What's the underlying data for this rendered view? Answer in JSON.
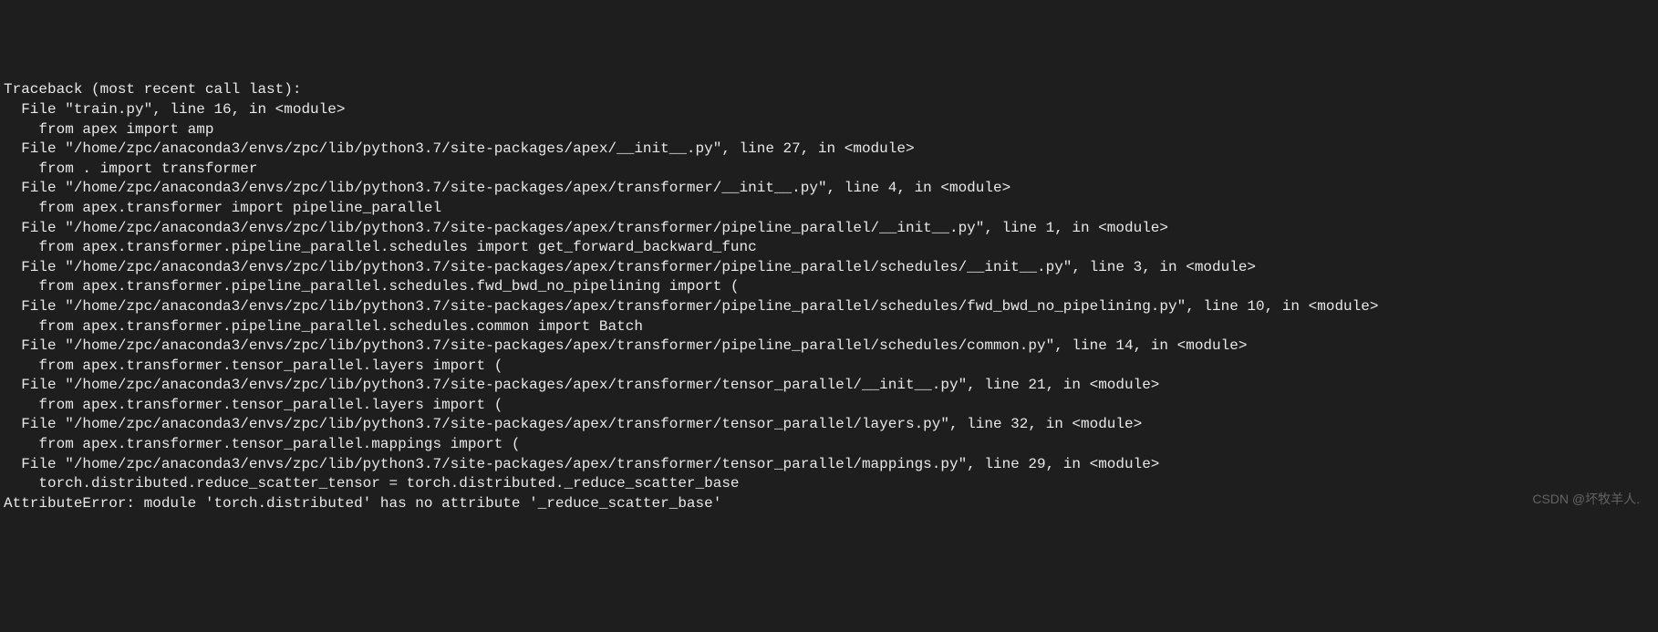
{
  "terminal": {
    "lines": [
      "Traceback (most recent call last):",
      "  File \"train.py\", line 16, in <module>",
      "    from apex import amp",
      "  File \"/home/zpc/anaconda3/envs/zpc/lib/python3.7/site-packages/apex/__init__.py\", line 27, in <module>",
      "    from . import transformer",
      "  File \"/home/zpc/anaconda3/envs/zpc/lib/python3.7/site-packages/apex/transformer/__init__.py\", line 4, in <module>",
      "    from apex.transformer import pipeline_parallel",
      "  File \"/home/zpc/anaconda3/envs/zpc/lib/python3.7/site-packages/apex/transformer/pipeline_parallel/__init__.py\", line 1, in <module>",
      "    from apex.transformer.pipeline_parallel.schedules import get_forward_backward_func",
      "  File \"/home/zpc/anaconda3/envs/zpc/lib/python3.7/site-packages/apex/transformer/pipeline_parallel/schedules/__init__.py\", line 3, in <module>",
      "    from apex.transformer.pipeline_parallel.schedules.fwd_bwd_no_pipelining import (",
      "  File \"/home/zpc/anaconda3/envs/zpc/lib/python3.7/site-packages/apex/transformer/pipeline_parallel/schedules/fwd_bwd_no_pipelining.py\", line 10, in <module>",
      "    from apex.transformer.pipeline_parallel.schedules.common import Batch",
      "  File \"/home/zpc/anaconda3/envs/zpc/lib/python3.7/site-packages/apex/transformer/pipeline_parallel/schedules/common.py\", line 14, in <module>",
      "    from apex.transformer.tensor_parallel.layers import (",
      "  File \"/home/zpc/anaconda3/envs/zpc/lib/python3.7/site-packages/apex/transformer/tensor_parallel/__init__.py\", line 21, in <module>",
      "    from apex.transformer.tensor_parallel.layers import (",
      "  File \"/home/zpc/anaconda3/envs/zpc/lib/python3.7/site-packages/apex/transformer/tensor_parallel/layers.py\", line 32, in <module>",
      "    from apex.transformer.tensor_parallel.mappings import (",
      "  File \"/home/zpc/anaconda3/envs/zpc/lib/python3.7/site-packages/apex/transformer/tensor_parallel/mappings.py\", line 29, in <module>",
      "    torch.distributed.reduce_scatter_tensor = torch.distributed._reduce_scatter_base",
      "AttributeError: module 'torch.distributed' has no attribute '_reduce_scatter_base'"
    ]
  },
  "watermark": "CSDN @坏牧羊人."
}
